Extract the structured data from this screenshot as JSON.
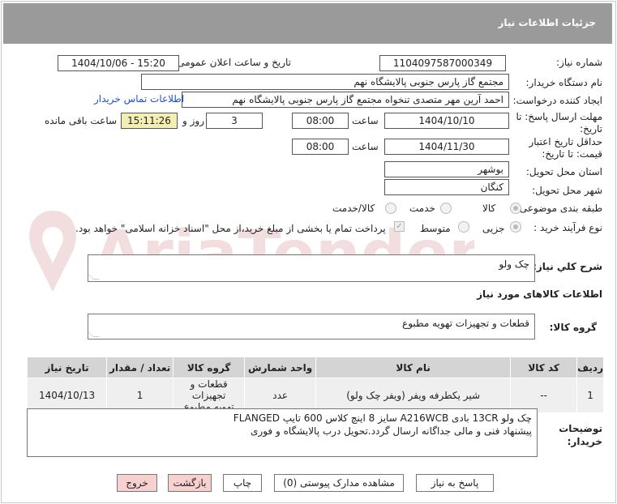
{
  "header": {
    "title": "جزئیات اطلاعات نیاز"
  },
  "form": {
    "need_number_label": "شماره نیاز:",
    "need_number": "1104097587000349",
    "announce_label": "تاریخ و ساعت اعلان عمومی:",
    "announce_value": "1404/10/06 - 15:20",
    "buyer_org_label": "نام دستگاه خریدار:",
    "buyer_org": "مجتمع گاز پارس جنوبی  پالایشگاه نهم",
    "creator_label": "ایجاد کننده درخواست:",
    "creator": "احمد آرین مهر متصدی تنخواه مجتمع گاز پارس جنوبی  پالایشگاه نهم",
    "contact_link": "اطلاعات تماس خریدار",
    "deadline_label_1": "مهلت ارسال پاسخ: تا",
    "deadline_label_2": "تاریخ:",
    "deadline_date": "1404/10/10",
    "time_label": "ساعت",
    "deadline_time": "08:00",
    "days_value": "3",
    "days_label": "روز و",
    "remaining_time": "15:11:26",
    "remaining_label": "ساعت باقی مانده",
    "validity_label_1": "حداقل تاریخ اعتبار",
    "validity_label_2": "قیمت: تا تاریخ:",
    "validity_date": "1404/11/30",
    "validity_time": "08:00",
    "province_label": "استان محل تحویل:",
    "province": "بوشهر",
    "city_label": "شهر محل تحویل:",
    "city": "کنگان",
    "category_label": "طبقه بندی موضوعی:",
    "category_options": [
      "کالا",
      "خدمت",
      "کالا/خدمت"
    ],
    "category_selected": "کالا",
    "process_label": "نوع فرآیند خرید :",
    "process_options": [
      "جزیی",
      "متوسط"
    ],
    "process_selected": "جزیی",
    "treasury_note": "پرداخت تمام یا بخشی از مبلغ خرید،از محل \"اسناد خزانه اسلامی\" خواهد بود."
  },
  "description": {
    "label": "شرح کلي نياز:",
    "value": "چک ولو"
  },
  "goods_section": {
    "title": "اطلاعات کالاهای مورد نیاز"
  },
  "goods_group": {
    "label": "گروه کالا:",
    "value": "قطعات و تجهیزات تهویه مطبوع"
  },
  "table": {
    "headers": [
      "ردیف",
      "کد کالا",
      "نام کالا",
      "واحد شمارش",
      "گروه کالا",
      "تعداد / مقدار",
      "تاریخ نیاز"
    ],
    "rows": [
      {
        "row": "1",
        "code": "--",
        "name": "شیر یکطرفه ویفر (ویفر چک ولو)",
        "unit": "عدد",
        "group_line1": "قطعات و تجهیزات",
        "group_line2": "تهویه مطبوع",
        "qty": "1",
        "date": "1404/10/13"
      }
    ]
  },
  "buyer_notes": {
    "label_1": "توضیحات",
    "label_2": "خریدار:",
    "line1": "چک ولو 13CR بادی A216WCB سایز 8 اینچ کلاس 600 تایپ FLANGED",
    "line2": "پیشنهاد فنی و مالی جداگانه ارسال گردد.تحویل درب پالایشگاه و فوری"
  },
  "buttons": {
    "reply": "پاسخ به نیاز",
    "attachments": "مشاهده مدارک پیوستی (0)",
    "print": "چاپ",
    "back": "بازگشت",
    "exit": "خروج"
  },
  "watermark": {
    "text": "AriaTender.neT"
  },
  "colors": {
    "header_bg": "#9a9a9a",
    "link": "#1e50d2",
    "remaining_bg": "#f3efb4",
    "button_pink": "#f7d0d0",
    "watermark": "#f2dede"
  }
}
